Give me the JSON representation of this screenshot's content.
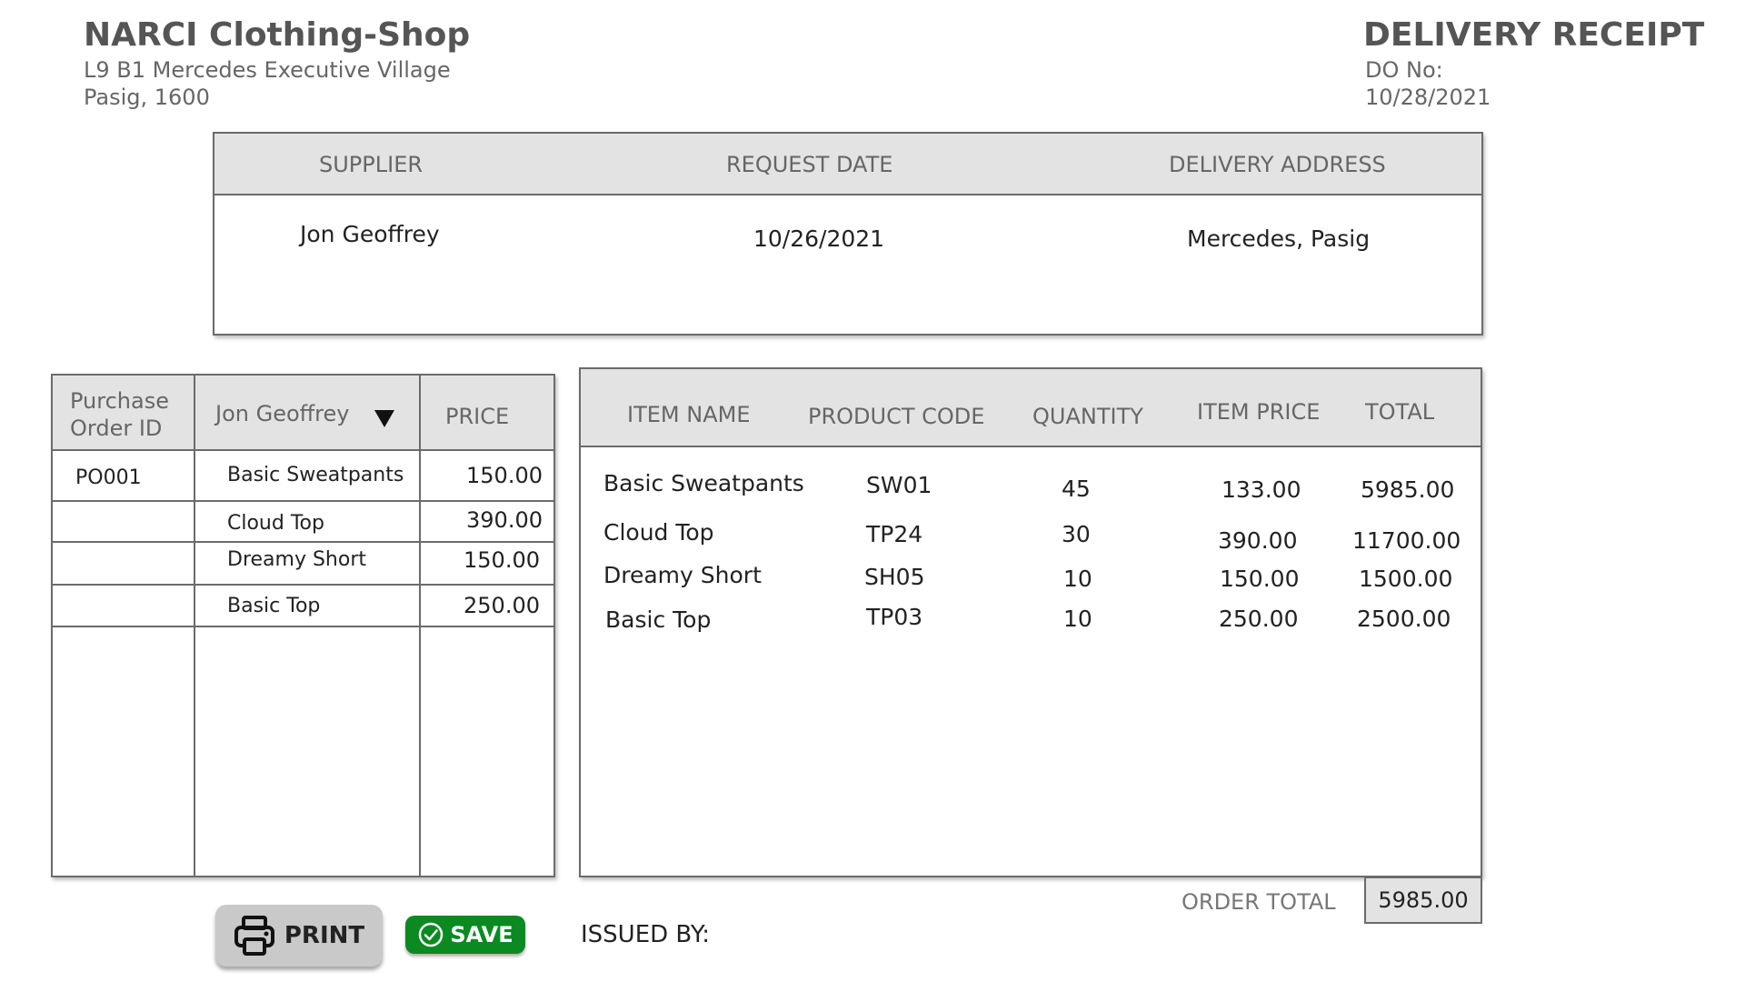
{
  "shop": {
    "name": "NARCI Clothing-Shop",
    "address_line1": "L9 B1 Mercedes Executive Village",
    "address_line2": "Pasig, 1600"
  },
  "document": {
    "title": "DELIVERY RECEIPT",
    "do_label": "DO No:",
    "date": "10/28/2021"
  },
  "info": {
    "headers": [
      "SUPPLIER",
      "REQUEST DATE",
      "DELIVERY ADDRESS"
    ],
    "supplier": "Jon Geoffrey",
    "request_date": "10/26/2021",
    "delivery_address": "Mercedes, Pasig"
  },
  "po_table": {
    "header_po_line1": "Purchase",
    "header_po_line2": "Order ID",
    "supplier_select": "Jon Geoffrey",
    "header_price": "PRICE",
    "rows": [
      {
        "po_id": "PO001",
        "item": "Basic Sweatpants",
        "price": "150.00"
      },
      {
        "po_id": "",
        "item": "Cloud Top",
        "price": "390.00"
      },
      {
        "po_id": "",
        "item": "Dreamy Short",
        "price": "150.00"
      },
      {
        "po_id": "",
        "item": "Basic Top",
        "price": "250.00"
      }
    ]
  },
  "items_table": {
    "headers": [
      "ITEM NAME",
      "PRODUCT CODE",
      "QUANTITY",
      "ITEM PRICE",
      "TOTAL"
    ],
    "rows": [
      {
        "name": "Basic Sweatpants",
        "code": "SW01",
        "qty": "45",
        "price": "133.00",
        "total": "5985.00"
      },
      {
        "name": "Cloud Top",
        "code": "TP24",
        "qty": "30",
        "price": "390.00",
        "total": "11700.00"
      },
      {
        "name": "Dreamy Short",
        "code": "SH05",
        "qty": "10",
        "price": "150.00",
        "total": "1500.00"
      },
      {
        "name": "Basic Top",
        "code": "TP03",
        "qty": "10",
        "price": "250.00",
        "total": "2500.00"
      }
    ]
  },
  "footer": {
    "order_total_label": "ORDER TOTAL",
    "order_total_value": "5985.00",
    "print_label": "PRINT",
    "save_label": "SAVE",
    "issued_by_label": "ISSUED BY:"
  },
  "colors": {
    "header_gray": "#e3e3e3",
    "save_green": "#0b8a22",
    "print_gray": "#c9c9c9"
  }
}
